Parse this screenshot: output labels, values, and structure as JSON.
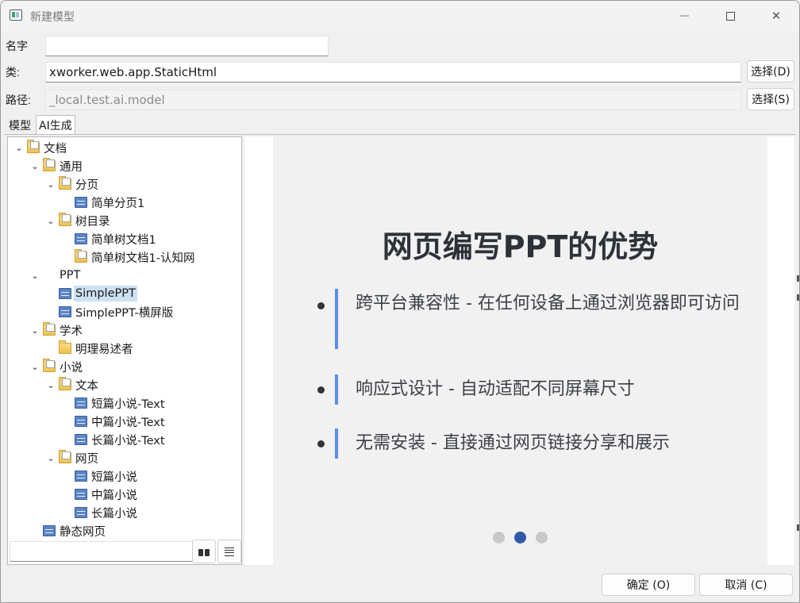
{
  "window": {
    "title": "新建模型"
  },
  "form": {
    "name_label": "名字",
    "name_value": "",
    "class_label": "类:",
    "class_value": "xworker.web.app.StaticHtml",
    "class_button": "选择(D)",
    "path_label": "路径:",
    "path_value": "_local.test.ai.model",
    "path_button": "选择(S)"
  },
  "tabs": [
    {
      "label": "模型",
      "active": false
    },
    {
      "label": "AI生成",
      "active": true
    }
  ],
  "tree": [
    {
      "label": "文档",
      "level": 0,
      "icon": "folder-doc",
      "expanded": true
    },
    {
      "label": "通用",
      "level": 1,
      "icon": "folder-doc",
      "expanded": true
    },
    {
      "label": "分页",
      "level": 2,
      "icon": "folder-doc",
      "expanded": true
    },
    {
      "label": "简单分页1",
      "level": 3,
      "icon": "html-icon"
    },
    {
      "label": "树目录",
      "level": 2,
      "icon": "folder-doc",
      "expanded": true
    },
    {
      "label": "简单树文档1",
      "level": 3,
      "icon": "html-icon"
    },
    {
      "label": "简单树文档1-认知网",
      "level": 3,
      "icon": "folder-doc"
    },
    {
      "label": "PPT",
      "level": 1,
      "icon": "none",
      "expanded": true
    },
    {
      "label": "SimplePPT",
      "level": 2,
      "icon": "html-icon",
      "selected": true
    },
    {
      "label": "SimplePPT-横屏版",
      "level": 2,
      "icon": "html-icon"
    },
    {
      "label": "学术",
      "level": 1,
      "icon": "folder-doc",
      "expanded": true
    },
    {
      "label": "明理易述者",
      "level": 2,
      "icon": "folder"
    },
    {
      "label": "小说",
      "level": 1,
      "icon": "folder-doc",
      "expanded": true
    },
    {
      "label": "文本",
      "level": 2,
      "icon": "folder-doc",
      "expanded": true
    },
    {
      "label": "短篇小说-Text",
      "level": 3,
      "icon": "html-icon"
    },
    {
      "label": "中篇小说-Text",
      "level": 3,
      "icon": "html-icon"
    },
    {
      "label": "长篇小说-Text",
      "level": 3,
      "icon": "html-icon"
    },
    {
      "label": "网页",
      "level": 2,
      "icon": "folder-doc",
      "expanded": true
    },
    {
      "label": "短篇小说",
      "level": 3,
      "icon": "html-icon"
    },
    {
      "label": "中篇小说",
      "level": 3,
      "icon": "html-icon"
    },
    {
      "label": "长篇小说",
      "level": 3,
      "icon": "html-icon"
    },
    {
      "label": "静态网页",
      "level": 1,
      "icon": "html-icon"
    }
  ],
  "tree_search": {
    "value": ""
  },
  "slide": {
    "title": "网页编写PPT的优势",
    "bullets": [
      "跨平台兼容性 - 在任何设备上通过浏览器即可访问",
      "响应式设计 - 自动适配不同屏幕尺寸",
      "无需安装 - 直接通过网页链接分享和展示"
    ],
    "page_count": 3,
    "current_page": 2,
    "accent_color": "#5b8ded"
  },
  "footer": {
    "ok_label": "确定 (O)",
    "cancel_label": "取消 (C)"
  }
}
